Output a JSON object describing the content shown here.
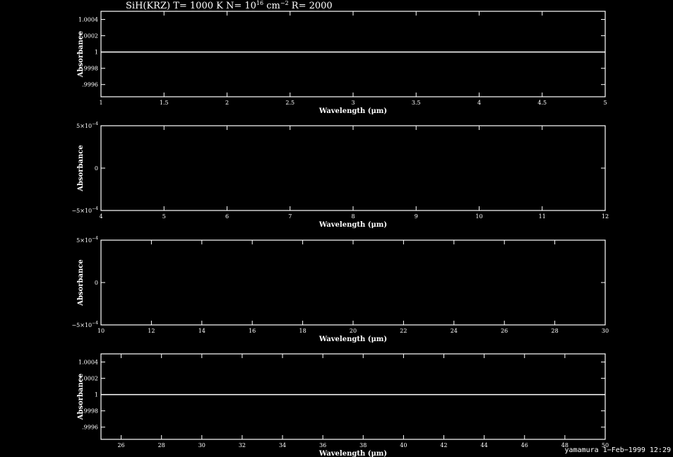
{
  "title": "SiH(KRZ) T= 1000 K N= 10^16 cm^-2 R= 2000",
  "title_parts": {
    "lead": "SiH(KRZ) T= 1000 K N= 10",
    "exp1": "16",
    "mid": " cm",
    "exp2": "−2",
    "tail": " R= 2000"
  },
  "footer": "yamamura  1−Feb−1999 12:29",
  "colors": {
    "background": "#000000",
    "foreground": "#ffffff"
  },
  "chart_data": [
    {
      "type": "line",
      "xlabel": "Wavelength (μm)",
      "ylabel": "Absorbance",
      "xlim": [
        1,
        5
      ],
      "ylim": [
        0.99945,
        1.0005
      ],
      "xticks": [
        1,
        1.5,
        2,
        2.5,
        3,
        3.5,
        4,
        4.5,
        5
      ],
      "xtick_labels": [
        "1",
        "1.5",
        "2",
        "2.5",
        "3",
        "3.5",
        "4",
        "4.5",
        "5"
      ],
      "yticks": [
        0.9996,
        0.9998,
        1,
        1.0002,
        1.0004
      ],
      "ytick_labels": [
        ".9996",
        ".9998",
        "1",
        "1.0002",
        "1.0004"
      ],
      "series": [
        {
          "x": [
            1,
            5
          ],
          "y": [
            1,
            1
          ]
        }
      ]
    },
    {
      "type": "line",
      "xlabel": "Wavelength (μm)",
      "ylabel": "Absorbance",
      "xlim": [
        4,
        12
      ],
      "ylim": [
        -0.0005,
        0.0005
      ],
      "xticks": [
        4,
        5,
        6,
        7,
        8,
        9,
        10,
        11,
        12
      ],
      "xtick_labels": [
        "4",
        "5",
        "6",
        "7",
        "8",
        "9",
        "10",
        "11",
        "12"
      ],
      "yticks": [
        -0.0005,
        0,
        0.0005
      ],
      "ytick_labels": [
        "−5×10^−4",
        "0",
        "5×10^−4"
      ],
      "series": []
    },
    {
      "type": "line",
      "xlabel": "Wavelength (μm)",
      "ylabel": "Absorbance",
      "xlim": [
        10,
        30
      ],
      "ylim": [
        -0.0005,
        0.0005
      ],
      "xticks": [
        10,
        12,
        14,
        16,
        18,
        20,
        22,
        24,
        26,
        28,
        30
      ],
      "xtick_labels": [
        "10",
        "12",
        "14",
        "16",
        "18",
        "20",
        "22",
        "24",
        "26",
        "28",
        "30"
      ],
      "yticks": [
        -0.0005,
        0,
        0.0005
      ],
      "ytick_labels": [
        "−5×10^−4",
        "0",
        "5×10^−4"
      ],
      "series": []
    },
    {
      "type": "line",
      "xlabel": "Wavelength (μm)",
      "ylabel": "Absorbance",
      "xlim": [
        25,
        50
      ],
      "ylim": [
        0.99945,
        1.0005
      ],
      "xticks": [
        26,
        28,
        30,
        32,
        34,
        36,
        38,
        40,
        42,
        44,
        46,
        48,
        50
      ],
      "xtick_labels": [
        "26",
        "28",
        "30",
        "32",
        "34",
        "36",
        "38",
        "40",
        "42",
        "44",
        "46",
        "48",
        "50"
      ],
      "yticks": [
        0.9996,
        0.9998,
        1,
        1.0002,
        1.0004
      ],
      "ytick_labels": [
        ".9996",
        ".9998",
        "1",
        "1.0002",
        "1.0004"
      ],
      "series": [
        {
          "x": [
            25,
            50
          ],
          "y": [
            1,
            1
          ]
        }
      ]
    }
  ]
}
